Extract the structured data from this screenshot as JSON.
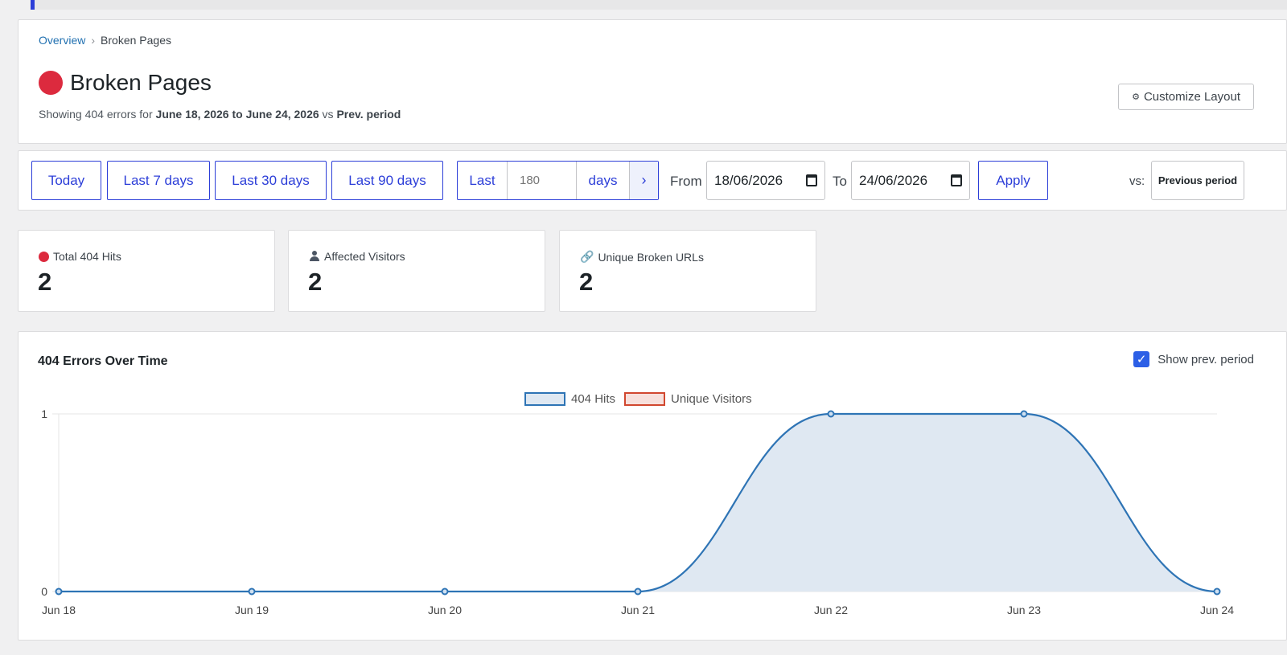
{
  "breadcrumb": {
    "parent": "Overview",
    "separator": "›",
    "current": "Broken Pages"
  },
  "page": {
    "title": "Broken Pages",
    "subtitle_prefix": "Showing 404 errors for ",
    "date_range": "June 18, 2026 to June 24, 2026",
    "subtitle_vs": " vs ",
    "compare_period": "Prev. period",
    "customize_icon": "⚙",
    "customize_label": "Customize Layout"
  },
  "toolbar": {
    "today": "Today",
    "last7": "Last 7 days",
    "last30": "Last 30 days",
    "last90": "Last 90 days",
    "custom_last": "Last",
    "custom_days_placeholder": "180",
    "custom_days_unit": "days",
    "go_icon": "›",
    "from_label": "From",
    "from_value": "18/06/2026",
    "to_label": "To",
    "to_value": "24/06/2026",
    "apply": "Apply",
    "vs_label": "vs:",
    "vs_value": "Previous period"
  },
  "stats": [
    {
      "label": "Total 404 Hits",
      "value": "2",
      "icon": "red-dot"
    },
    {
      "label": "Affected Visitors",
      "value": "2",
      "icon": "person-icon"
    },
    {
      "label": "Unique Broken URLs",
      "value": "2",
      "icon": "link-icon"
    }
  ],
  "chart_section": {
    "title": "404 Errors Over Time",
    "show_prev_label": "Show prev. period",
    "show_prev_checked": true
  },
  "chart_data": {
    "type": "area",
    "x": [
      "Jun 18",
      "Jun 19",
      "Jun 20",
      "Jun 21",
      "Jun 22",
      "Jun 23",
      "Jun 24"
    ],
    "series": [
      {
        "name": "404 Hits",
        "values": [
          0,
          0,
          0,
          0,
          1,
          1,
          0
        ],
        "color": "#2e74b5",
        "fill": "#dfe8f2"
      },
      {
        "name": "Unique Visitors",
        "values": [],
        "color": "#d1472f",
        "fill": "#f7e0dc"
      }
    ],
    "yticks": [
      "0",
      "1"
    ],
    "ylim": [
      0,
      1
    ],
    "legend": "top-center",
    "grid": true
  }
}
